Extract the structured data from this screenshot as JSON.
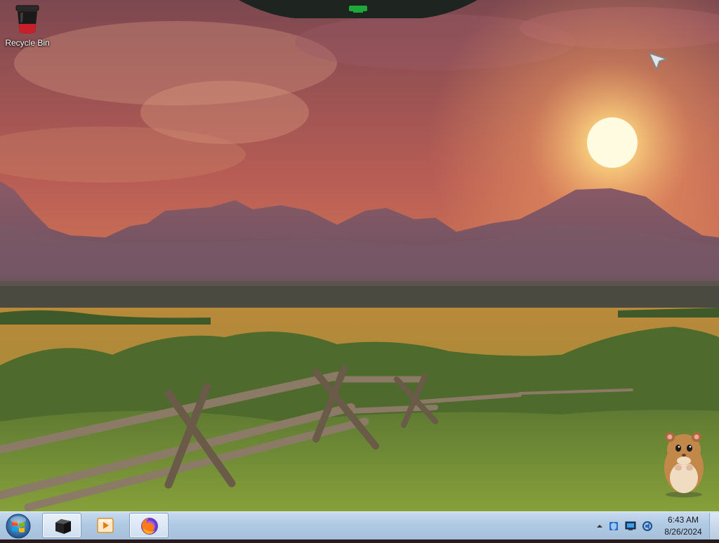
{
  "desktop": {
    "icons": [
      {
        "label": "Recycle Bin",
        "icon": "recycle-bin-icon"
      }
    ],
    "wallpaper": "mountain-sunset-meadow-fence"
  },
  "taskbar": {
    "start_icon": "windows-logo-icon",
    "pinned": [
      {
        "name": "command-prompt",
        "icon": "terminal-icon",
        "active": true
      },
      {
        "name": "media-player",
        "icon": "media-player-icon",
        "active": false
      },
      {
        "name": "firefox",
        "icon": "firefox-icon",
        "active": true
      }
    ],
    "tray_icons": [
      "show-hidden-icons-chevron",
      "security-shield-icon",
      "network-monitor-icon",
      "speaker-icon"
    ],
    "clock": {
      "time": "6:43 AM",
      "date": "8/26/2024"
    }
  },
  "colors": {
    "taskbar": "#b0c9e3",
    "sky_top": "#8a4a4a",
    "sun": "#fff6c8"
  }
}
